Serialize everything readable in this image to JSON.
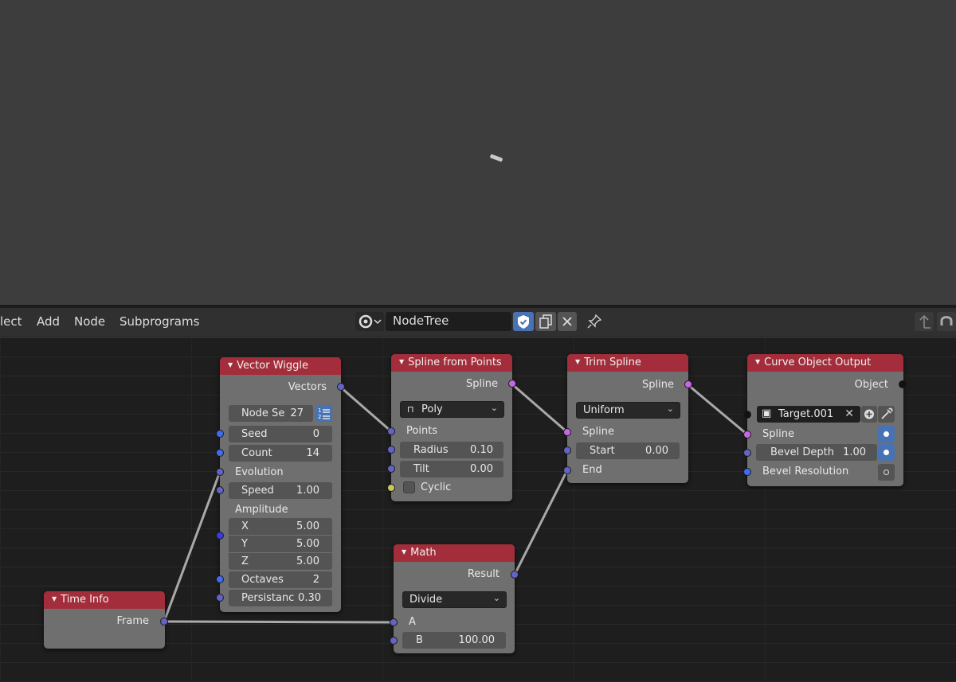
{
  "header": {
    "menu": [
      "lect",
      "Add",
      "Node",
      "Subprograms"
    ],
    "tree_name": "NodeTree"
  },
  "nodes": {
    "vector_wiggle": {
      "title": "Vector Wiggle",
      "output": "Vectors",
      "node_seed_label": "Node Se",
      "node_seed_value": "27",
      "seed_label": "Seed",
      "seed_value": "0",
      "count_label": "Count",
      "count_value": "14",
      "evolution_label": "Evolution",
      "speed_label": "Speed",
      "speed_value": "1.00",
      "amplitude_label": "Amplitude",
      "x_label": "X",
      "x_value": "5.00",
      "y_label": "Y",
      "y_value": "5.00",
      "z_label": "Z",
      "z_value": "5.00",
      "octaves_label": "Octaves",
      "octaves_value": "2",
      "persistance_label": "Persistanc",
      "persistance_value": "0.30"
    },
    "spline_from_points": {
      "title": "Spline from Points",
      "output": "Spline",
      "type_value": "Poly",
      "points_label": "Points",
      "radius_label": "Radius",
      "radius_value": "0.10",
      "tilt_label": "Tilt",
      "tilt_value": "0.00",
      "cyclic_label": "Cyclic"
    },
    "trim_spline": {
      "title": "Trim Spline",
      "output": "Spline",
      "mode_value": "Uniform",
      "spline_label": "Spline",
      "start_label": "Start",
      "start_value": "0.00",
      "end_label": "End"
    },
    "curve_object_output": {
      "title": "Curve Object Output",
      "output": "Object",
      "object_value": "Target.001",
      "spline_label": "Spline",
      "bevel_depth_label": "Bevel Depth",
      "bevel_depth_value": "1.00",
      "bevel_resolution_label": "Bevel Resolution"
    },
    "math": {
      "title": "Math",
      "output": "Result",
      "operation_value": "Divide",
      "a_label": "A",
      "b_label": "B",
      "b_value": "100.00"
    },
    "time_info": {
      "title": "Time Info",
      "output": "Frame"
    }
  },
  "colors": {
    "node_header": "#a32d3a",
    "node_body": "#6f6f6f",
    "socket_vector": "#6363c7",
    "socket_integer": "#3f6cf0",
    "socket_spline": "#c665e6",
    "socket_boolean": "#c7c760",
    "accent_blue": "#4772b3"
  }
}
